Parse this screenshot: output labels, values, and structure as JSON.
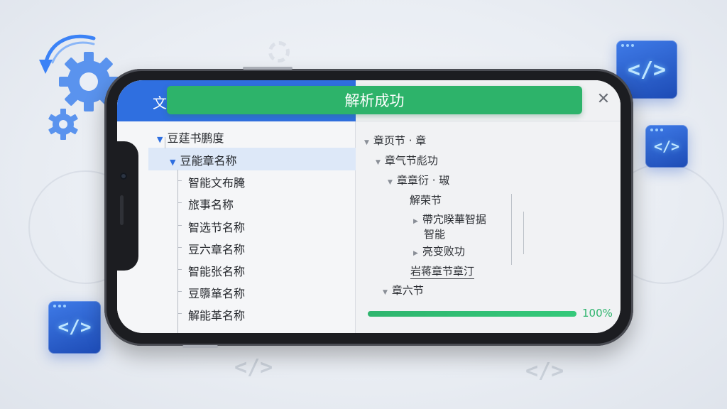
{
  "header": {
    "title": "文",
    "toast": "解析成功",
    "close_icon": "close-icon"
  },
  "left_tree": [
    {
      "label": "豆莛书鹏度",
      "level": 0,
      "expanded": true
    },
    {
      "label": "豆能章名称",
      "level": 1,
      "expanded": true,
      "selected": true
    },
    {
      "label": "智能文布腌",
      "level": 2
    },
    {
      "label": "旅事名称",
      "level": 2
    },
    {
      "label": "智选节名称",
      "level": 2
    },
    {
      "label": "豆六章名称",
      "level": 2
    },
    {
      "label": "智能张名称",
      "level": 2
    },
    {
      "label": "豆隳箪名称",
      "level": 2
    },
    {
      "label": "解能革名称",
      "level": 2
    }
  ],
  "right_tree": [
    {
      "label": "章页节 · 章"
    },
    {
      "label": "章气节彪功"
    },
    {
      "label": "章章衍 · 琡"
    },
    {
      "label": "解荣节"
    },
    {
      "label": "帶宂睽華智据"
    },
    {
      "label": "智能"
    },
    {
      "label": "亮变败功"
    },
    {
      "label": "岩蒋章节章汀"
    },
    {
      "label": "章六节"
    }
  ],
  "progress": {
    "value": 100,
    "label": "100%"
  },
  "decor": {
    "code_glyph": "</>",
    "accent_blue": "#2f6fe0",
    "success_green": "#2db36a"
  }
}
